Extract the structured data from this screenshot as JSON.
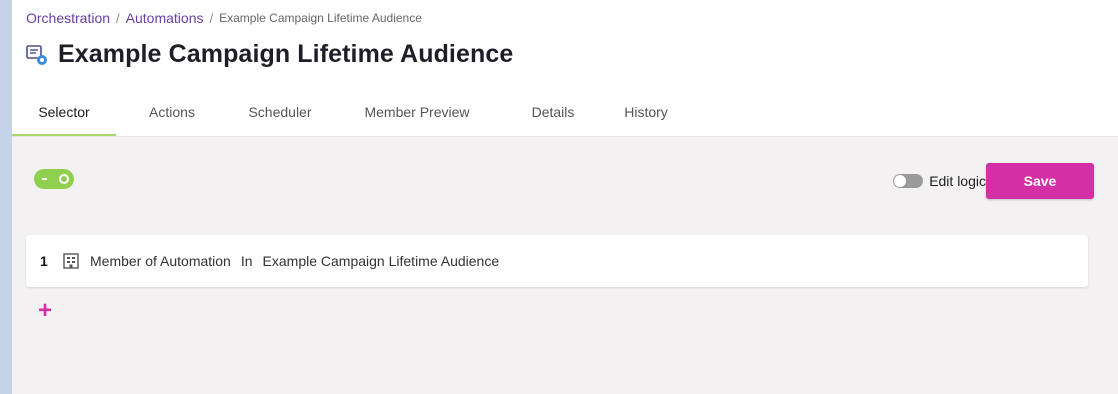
{
  "breadcrumb": {
    "items": [
      "Orchestration",
      "Automations"
    ],
    "separator": "/",
    "current": "Example Campaign Lifetime Audience"
  },
  "page": {
    "title": "Example Campaign Lifetime Audience"
  },
  "tabs": [
    {
      "label": "Selector",
      "active": true
    },
    {
      "label": "Actions",
      "active": false
    },
    {
      "label": "Scheduler",
      "active": false
    },
    {
      "label": "Member Preview",
      "active": false
    },
    {
      "label": "Details",
      "active": false
    },
    {
      "label": "History",
      "active": false
    }
  ],
  "toolbar": {
    "enabled_toggle_on": true,
    "edit_logic_label": "Edit logic",
    "edit_logic_on": false,
    "save_label": "Save"
  },
  "rules": [
    {
      "number": "1",
      "icon": "building-icon",
      "field": "Member of Automation",
      "operator": "In",
      "value": "Example Campaign Lifetime Audience"
    }
  ],
  "add_label": "+",
  "colors": {
    "accent": "#d42fa5",
    "link": "#6b3fa0",
    "active_tab_underline": "#a8d96a",
    "toggle_on": "#8fd14f"
  }
}
